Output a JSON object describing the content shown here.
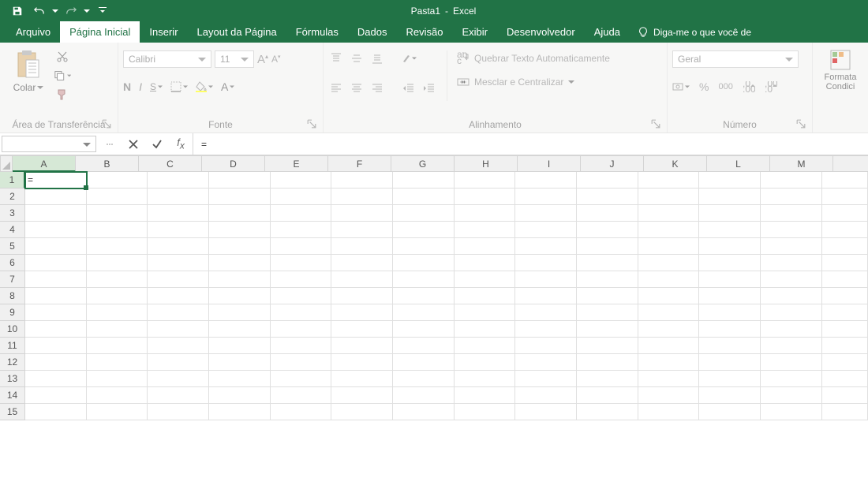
{
  "title": {
    "doc": "Pasta1",
    "sep": "-",
    "app": "Excel"
  },
  "tabs": [
    "Arquivo",
    "Página Inicial",
    "Inserir",
    "Layout da Página",
    "Fórmulas",
    "Dados",
    "Revisão",
    "Exibir",
    "Desenvolvedor",
    "Ajuda"
  ],
  "active_tab": 1,
  "tellme": "Diga-me o que você de",
  "groups": {
    "clipboard": {
      "label": "Área de Transferência",
      "paste": "Colar"
    },
    "font": {
      "label": "Fonte",
      "name": "Calibri",
      "size": "11",
      "bold": "N",
      "italic": "I",
      "underline": "S"
    },
    "alignment": {
      "label": "Alinhamento",
      "wrap": "Quebrar Texto Automaticamente",
      "merge": "Mesclar e Centralizar"
    },
    "number": {
      "label": "Número",
      "format": "Geral"
    },
    "styles": {
      "condfmt": "Formata\nCondici"
    }
  },
  "namebox": "",
  "formula": "=",
  "cols": [
    "A",
    "B",
    "C",
    "D",
    "E",
    "F",
    "G",
    "H",
    "I",
    "J",
    "K",
    "L",
    "M"
  ],
  "rows": [
    "1",
    "2",
    "3",
    "4",
    "5",
    "6",
    "7",
    "8",
    "9",
    "10",
    "11",
    "12",
    "13",
    "14",
    "15"
  ],
  "active_cell": {
    "row": 0,
    "col": 0,
    "display": "="
  }
}
